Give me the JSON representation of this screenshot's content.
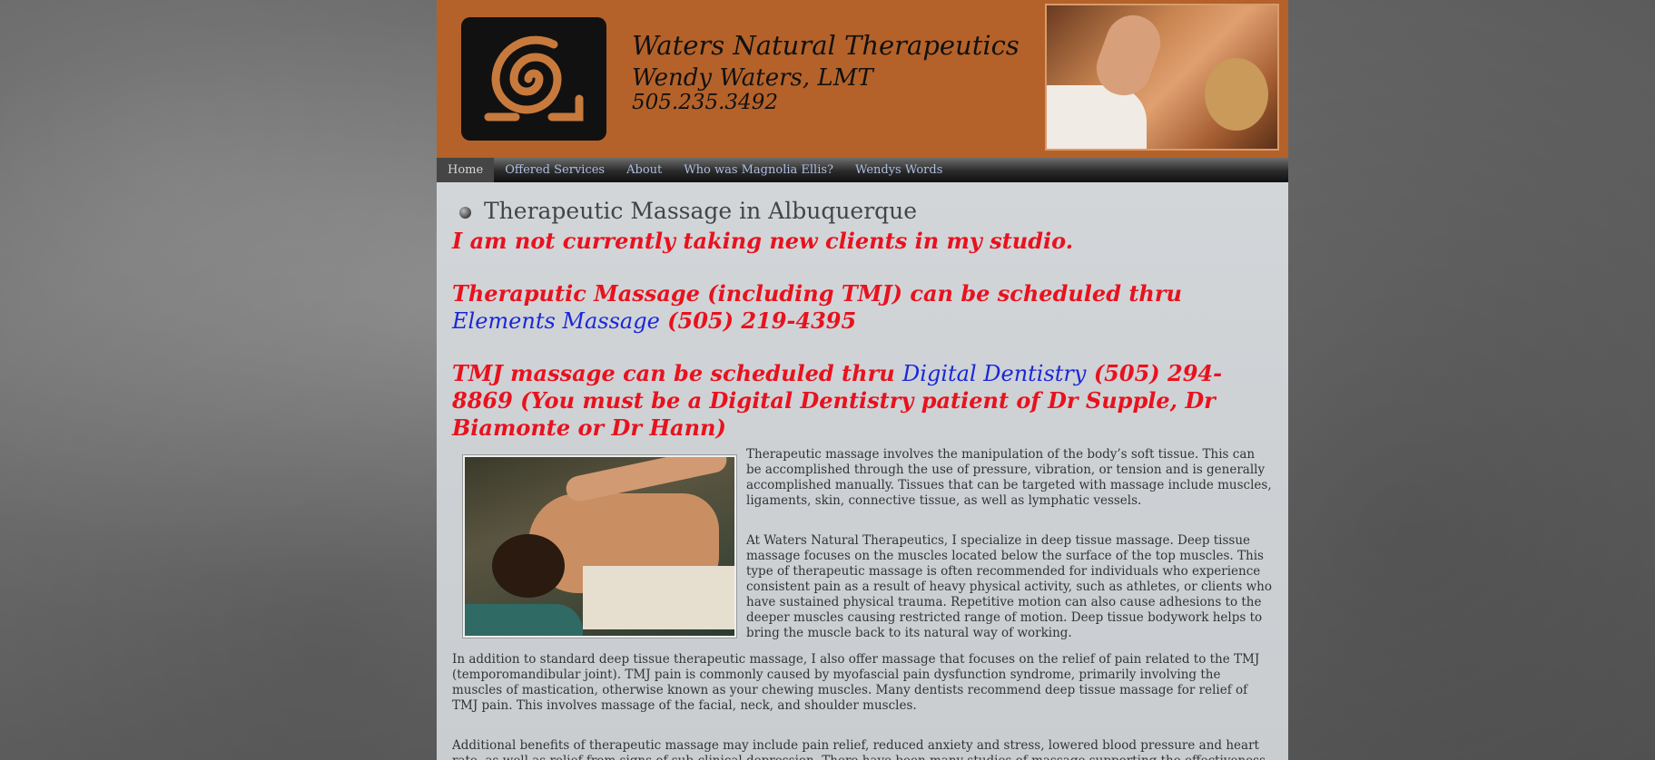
{
  "header": {
    "brand_name": "Waters Natural Therapeutics",
    "owner": "Wendy Waters, LMT",
    "phone": "505.235.3492"
  },
  "nav": {
    "items": [
      "Home",
      "Offered Services",
      "About",
      "Who was Magnolia Ellis?",
      "Wendys Words"
    ],
    "active": "Home"
  },
  "main": {
    "title": "Therapeutic Massage in Albuquerque",
    "notice_1": "I am not currently taking new clients in my studio.",
    "notice_2_a": "Theraputic Massage (including TMJ) can be scheduled thru ",
    "notice_2_link": "Elements Massage",
    "notice_2_b": " (505) 219-4395",
    "notice_3_a": "TMJ massage can be scheduled thru ",
    "notice_3_link": "Digital Dentistry",
    "notice_3_b": " (505) 294-8869 (You must be a Digital Dentistry patient of Dr Supple, Dr Biamonte or Dr Hann)",
    "para_1": "Therapeutic massage involves the manipulation of the body’s soft tissue. This can be accomplished through the use of pressure, vibration, or tension and is generally accomplished manually.  Tissues that can be targeted with massage include muscles, ligaments, skin, connective tissue, as well as lymphatic vessels.",
    "para_2": "At Waters Natural Therapeutics, I specialize in deep tissue massage. Deep tissue massage focuses on the muscles located below the surface of the top muscles. This type of therapeutic massage is often recommended for individuals who experience consistent pain as a result of heavy physical activity, such as athletes, or clients who have sustained physical trauma. Repetitive motion can also cause adhesions to the deeper muscles causing restricted range of motion. Deep tissue bodywork helps to bring the muscle back to its natural way of working.",
    "para_3": "In addition to standard deep tissue therapeutic massage, I also offer massage that focuses on the relief of pain related to the TMJ (temporomandibular joint). TMJ pain is commonly caused by myofascial pain dysfunction syndrome, primarily involving the muscles of mastication, otherwise known as your chewing muscles. Many dentists recommend deep tissue massage for relief of TMJ pain. This involves massage of the facial, neck, and shoulder muscles.",
    "para_4": "Additional benefits of therapeutic massage may include pain relief, reduced anxiety and stress, lowered blood pressure and heart rate, as well as relief from signs of sub-clinical depression. There have been many studies of massage supporting the effectiveness in reduction of symptoms for"
  },
  "colors": {
    "header_bg": "#b4622a",
    "notice_red": "#e8121e",
    "link_blue": "#1a27d8",
    "nav_text": "#aebde0"
  }
}
